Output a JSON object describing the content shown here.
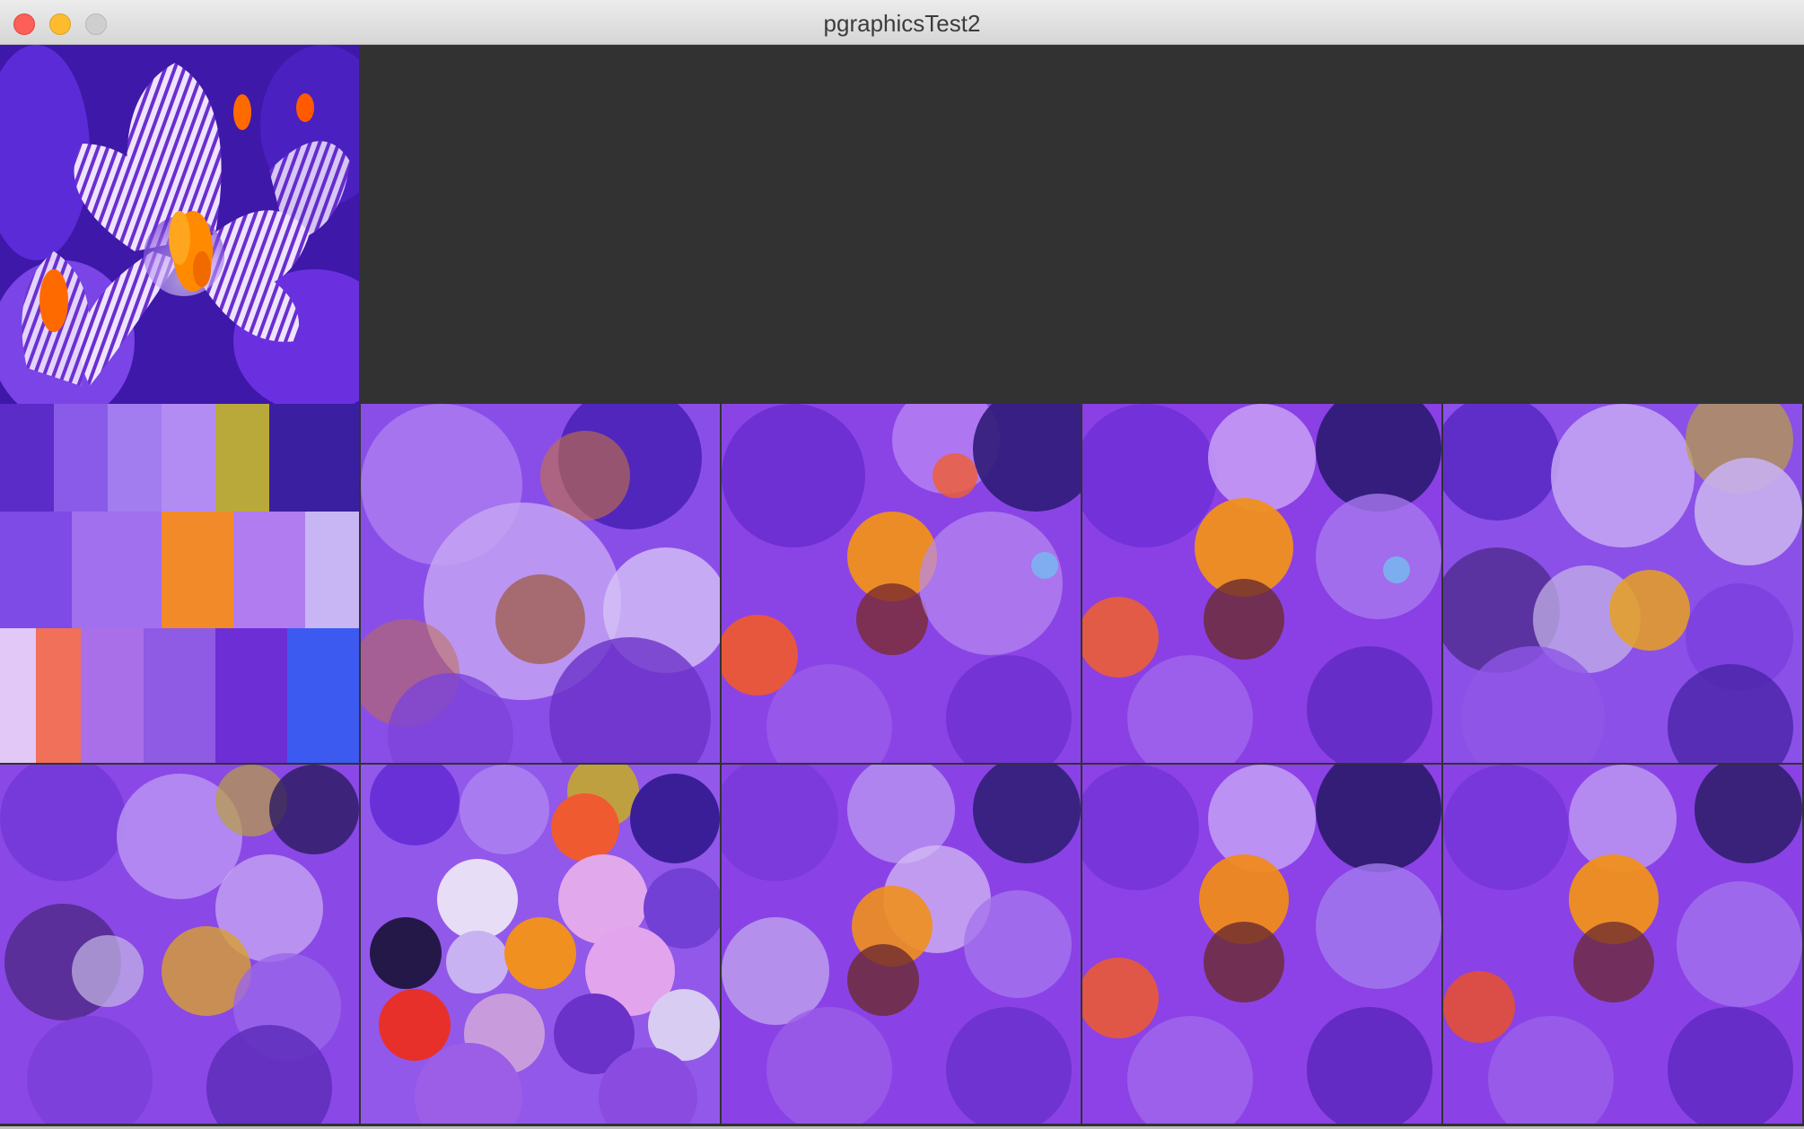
{
  "window": {
    "title": "pgraphicsTest2"
  },
  "colors": {
    "background": "#323232",
    "close": "#fc5f57",
    "minimize": "#fdbc2e",
    "zoom": "#cfcfcf"
  },
  "icons": [
    "close-button",
    "minimize-button",
    "zoom-button"
  ],
  "tiles": [
    {
      "kind": "photo",
      "subject": "crocus-flower"
    },
    {
      "kind": "painting"
    },
    {
      "kind": "painting"
    },
    {
      "kind": "painting"
    },
    {
      "kind": "painting"
    },
    {
      "kind": "painting"
    },
    {
      "kind": "painting"
    },
    {
      "kind": "painting"
    },
    {
      "kind": "painting"
    },
    {
      "kind": "painting"
    },
    {
      "kind": "painting"
    }
  ]
}
